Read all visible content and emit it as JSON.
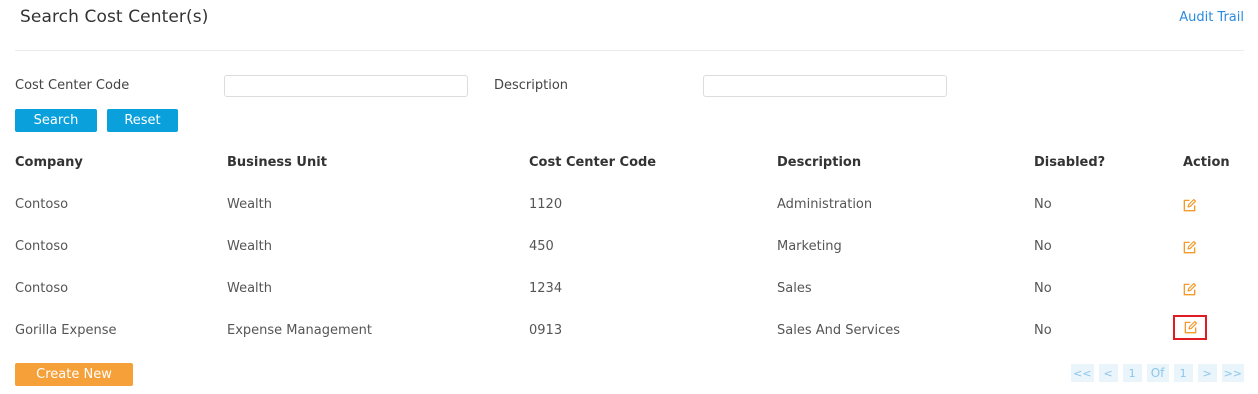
{
  "header": {
    "title": "Search Cost Center(s)",
    "audit_link": "Audit Trail"
  },
  "filters": {
    "cost_center_code_label": "Cost Center Code",
    "cost_center_code_value": "",
    "description_label": "Description",
    "description_value": ""
  },
  "buttons": {
    "search": "Search",
    "reset": "Reset",
    "create_new": "Create New"
  },
  "table": {
    "columns": {
      "company": "Company",
      "business_unit": "Business Unit",
      "cost_center_code": "Cost Center Code",
      "description": "Description",
      "disabled": "Disabled?",
      "action": "Action"
    },
    "rows": [
      {
        "company": "Contoso",
        "business_unit": "Wealth",
        "cost_center_code": "1120",
        "description": "Administration",
        "disabled": "No",
        "action_icon": "edit-icon"
      },
      {
        "company": "Contoso",
        "business_unit": "Wealth",
        "cost_center_code": "450",
        "description": "Marketing",
        "disabled": "No",
        "action_icon": "edit-icon"
      },
      {
        "company": "Contoso",
        "business_unit": "Wealth",
        "cost_center_code": "1234",
        "description": "Sales",
        "disabled": "No",
        "action_icon": "edit-icon"
      },
      {
        "company": "Gorilla Expense",
        "business_unit": "Expense Management",
        "cost_center_code": "0913",
        "description": "Sales And Services",
        "disabled": "No",
        "action_icon": "edit-icon",
        "highlighted": true
      }
    ]
  },
  "pagination": {
    "first": "<<",
    "prev": "<",
    "current_page": "1",
    "of_label": "Of",
    "total_pages": "1",
    "next": ">",
    "last": ">>"
  },
  "colors": {
    "primary_button": "#0aa0dc",
    "create_button": "#f6a03a",
    "link": "#2a8be0",
    "edit_icon": "#f39a2b",
    "highlight_border": "#e01b24"
  }
}
